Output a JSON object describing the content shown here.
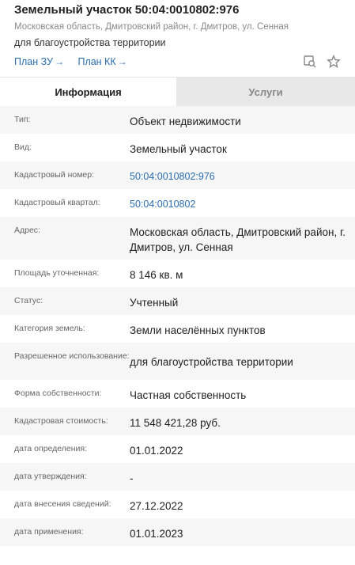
{
  "header": {
    "title": "Земельный участок 50:04:0010802:976",
    "address": "Московская область, Дмитровский район, г. Дмитров, ул. Сенная",
    "purpose": "для благоустройства территории",
    "links": [
      {
        "label": "План ЗУ",
        "arrow": "→"
      },
      {
        "label": "План КК",
        "arrow": "→"
      }
    ],
    "icons": [
      "search-map-icon",
      "star-icon"
    ]
  },
  "tabs": [
    {
      "label": "Информация",
      "active": true
    },
    {
      "label": "Услуги",
      "active": false
    }
  ],
  "rows": [
    {
      "label": "Тип:",
      "value": "Объект недвижимости"
    },
    {
      "label": "Вид:",
      "value": "Земельный участок"
    },
    {
      "label": "Кадастровый номер:",
      "value": "50:04:0010802:976",
      "link": true
    },
    {
      "label": "Кадастровый квартал:",
      "value": "50:04:0010802",
      "link": true
    },
    {
      "label": "Адрес:",
      "value": "Московская область, Дмитровский район, г. Дмитров, ул. Сенная"
    },
    {
      "label": "Площадь уточненная:",
      "value": "8 146 кв. м"
    },
    {
      "label": "Статус:",
      "value": "Учтенный"
    },
    {
      "label": "Категория земель:",
      "value": "Земли населённых пунктов"
    },
    {
      "label": "Разрешенное использование:",
      "value": "для благоустройства территории"
    },
    {
      "label": "Форма собственности:",
      "value": "Частная собственность"
    },
    {
      "label": "Кадастровая стоимость:",
      "value": "11 548 421,28 руб."
    },
    {
      "label": "дата определения:",
      "value": "01.01.2022"
    },
    {
      "label": "дата утверждения:",
      "value": "-"
    },
    {
      "label": "дата внесения сведений:",
      "value": "27.12.2022"
    },
    {
      "label": "дата применения:",
      "value": "01.01.2023"
    }
  ]
}
